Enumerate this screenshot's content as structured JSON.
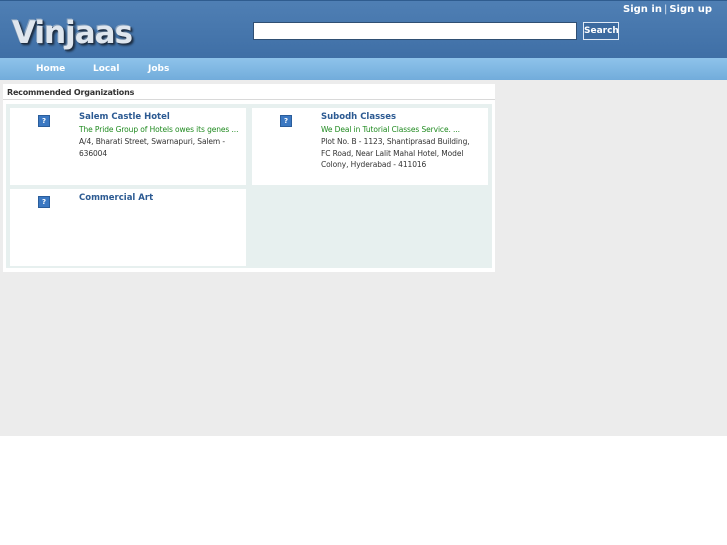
{
  "header": {
    "logo_text": "Vinjaas",
    "auth": {
      "sign_in": "Sign in",
      "separator": "|",
      "sign_up": "Sign up"
    },
    "search": {
      "value": "",
      "button_label": "Search"
    }
  },
  "nav": {
    "items": [
      {
        "label": "Home"
      },
      {
        "label": "Local"
      },
      {
        "label": "Jobs"
      }
    ]
  },
  "recommended": {
    "title": "Recommended Organizations",
    "thumb_glyph": "?",
    "organizations": [
      {
        "name": "Salem Castle Hotel",
        "description": "The Pride Group of Hotels owes its genes ...",
        "address": "A/4, Bharati Street, Swarnapuri, Salem - 636004"
      },
      {
        "name": "Subodh Classes",
        "description": "We Deal in Tutorial Classes Service. ...",
        "address": "Plot No. B - 1123, Shantiprasad Building, FC Road, Near Lalit Mahal Hotel, Model Colony, Hyderabad - 411016"
      },
      {
        "name": "Commercial Art",
        "description": "",
        "address": ""
      }
    ]
  },
  "colors": {
    "header_blue": "#4a7aaf",
    "nav_blue": "#7fb8e3",
    "link_blue": "#2c5a92",
    "desc_green": "#1f8a1f"
  }
}
